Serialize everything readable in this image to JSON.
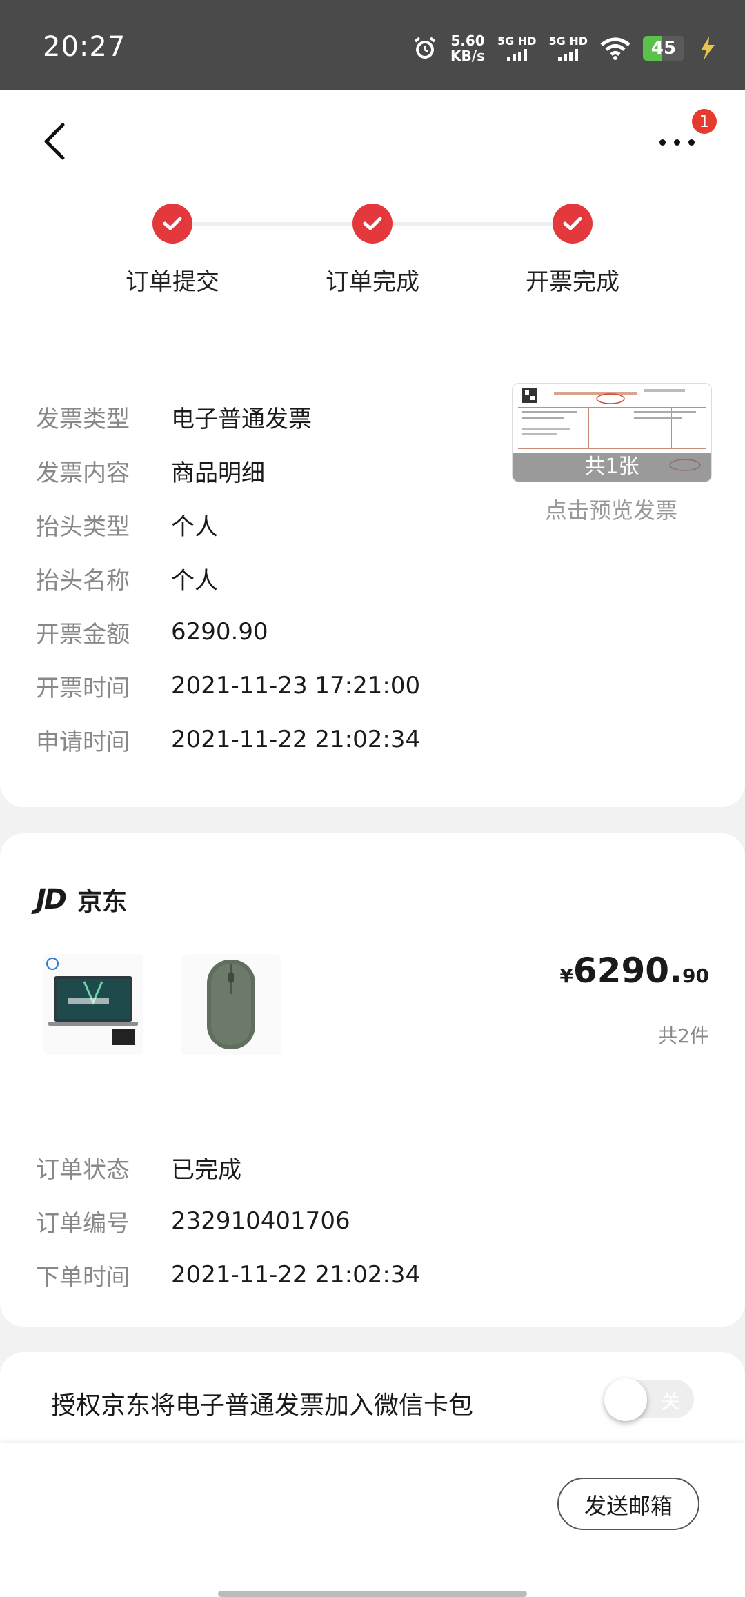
{
  "status_bar": {
    "time": "20:27",
    "net_speed": "5.60",
    "net_unit": "KB/s",
    "sim1": "5G HD",
    "sim2": "5G HD",
    "battery": "45",
    "battery_level": 0.45
  },
  "nav": {
    "more_badge": "1"
  },
  "steps": [
    {
      "label": "订单提交"
    },
    {
      "label": "订单完成"
    },
    {
      "label": "开票完成"
    }
  ],
  "invoice": {
    "rows": [
      {
        "key": "发票类型",
        "value": "电子普通发票"
      },
      {
        "key": "发票内容",
        "value": "商品明细"
      },
      {
        "key": "抬头类型",
        "value": "个人"
      },
      {
        "key": "抬头名称",
        "value": "个人"
      },
      {
        "key": "开票金额",
        "value": "6290.90"
      },
      {
        "key": "开票时间",
        "value": "2021-11-23 17:21:00"
      },
      {
        "key": "申请时间",
        "value": "2021-11-22 21:02:34"
      }
    ],
    "preview_count": "共1张",
    "preview_hint": "点击预览发票"
  },
  "order": {
    "shop_logo": "JD",
    "shop_name": "京东",
    "price_symbol": "¥",
    "price_main": "6290.",
    "price_decimal": "90",
    "quantity": "共2件",
    "rows": [
      {
        "key": "订单状态",
        "value": "已完成"
      },
      {
        "key": "订单编号",
        "value": "232910401706"
      },
      {
        "key": "下单时间",
        "value": "2021-11-22 21:02:34"
      }
    ]
  },
  "wechat": {
    "text": "授权京东将电子普通发票加入微信卡包",
    "toggle_text": "关"
  },
  "bottom": {
    "email_button": "发送邮箱"
  },
  "colors": {
    "accent": "#e4393c",
    "badge": "#e63a2e"
  }
}
